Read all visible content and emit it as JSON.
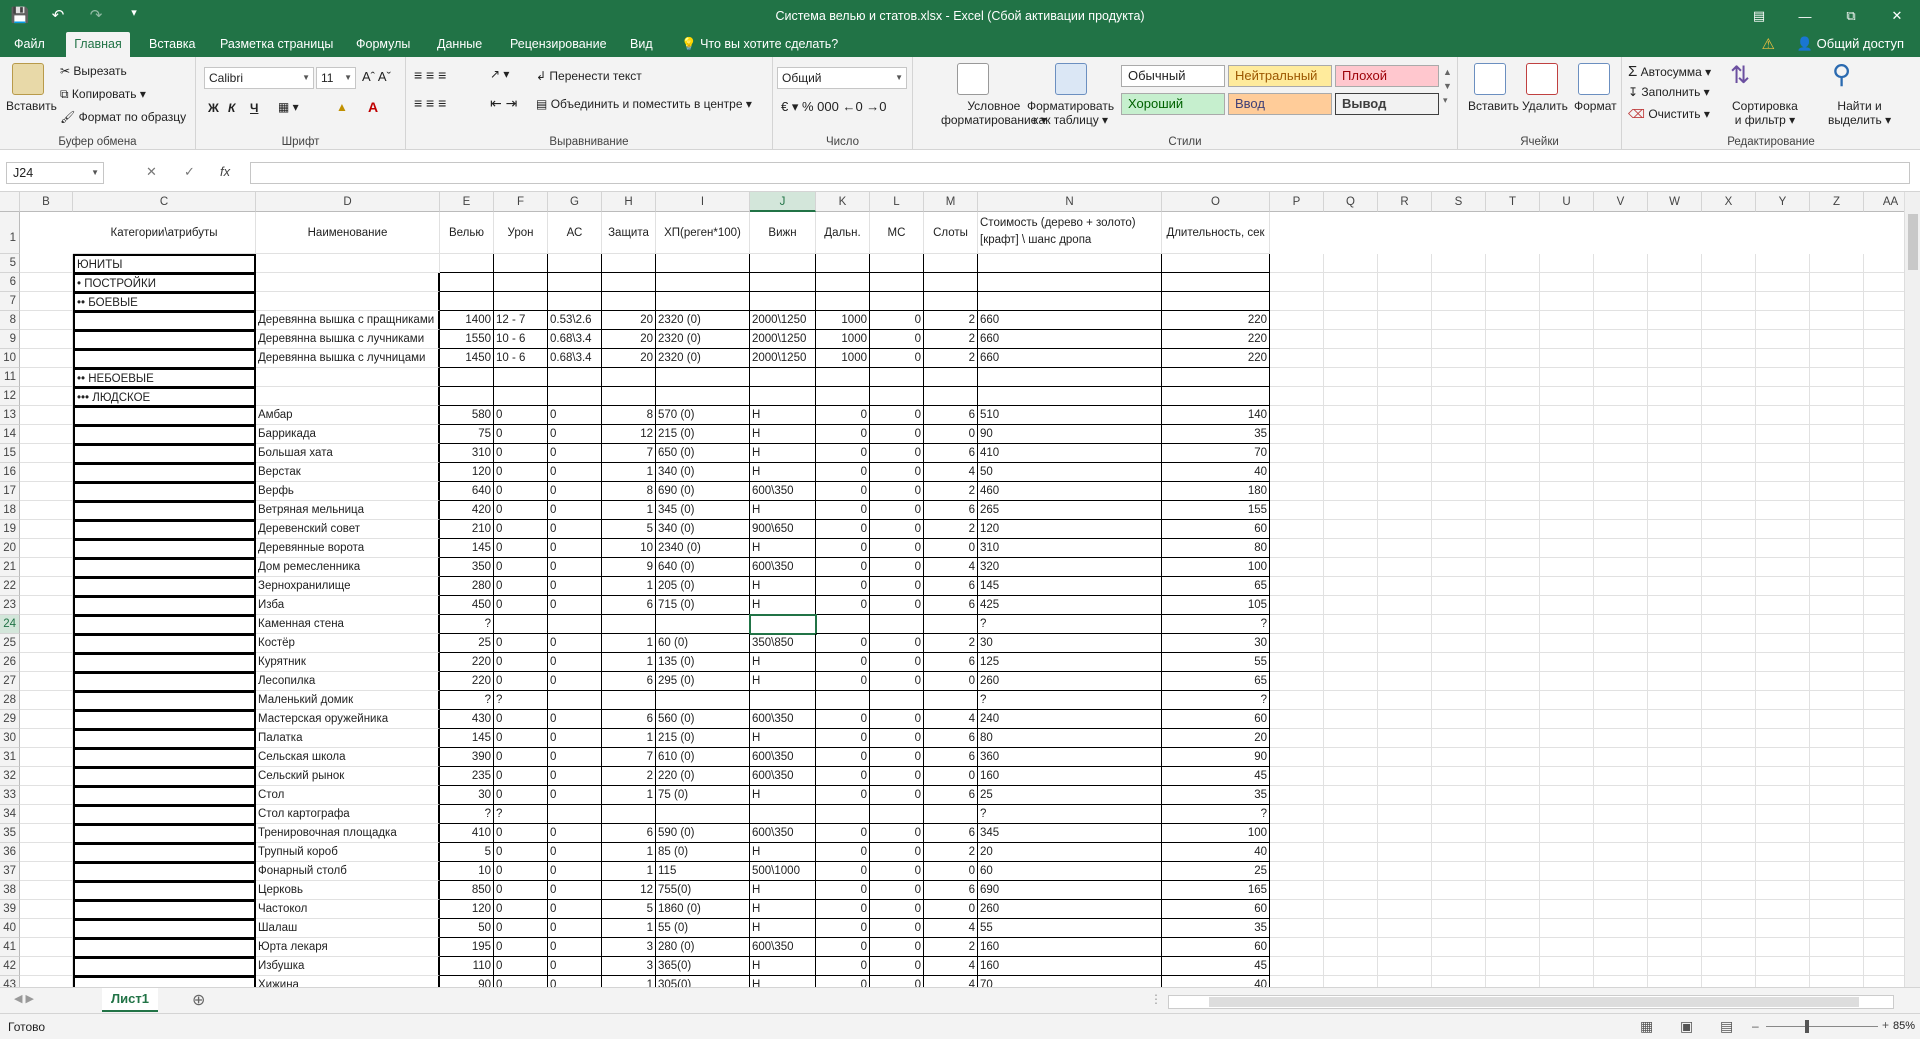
{
  "window": {
    "title": "Система велью и статов.xlsx - Excel (Сбой активации продукта)",
    "share": "Общий доступ"
  },
  "tabs": [
    "Файл",
    "Главная",
    "Вставка",
    "Разметка страницы",
    "Формулы",
    "Данные",
    "Рецензирование",
    "Вид",
    "Что вы хотите сделать?"
  ],
  "ribbon": {
    "clipboard": {
      "paste": "Вставить",
      "cut": "Вырезать",
      "copy": "Копировать",
      "format_painter": "Формат по образцу",
      "label": "Буфер обмена"
    },
    "font": {
      "name": "Calibri",
      "size": "11",
      "bold": "Ж",
      "italic": "К",
      "underline": "Ч",
      "label": "Шрифт"
    },
    "alignment": {
      "wrap": "Перенести текст",
      "merge": "Объединить и поместить в центре",
      "label": "Выравнивание"
    },
    "number": {
      "format": "Общий",
      "label": "Число"
    },
    "styles": {
      "conditional": "Условное",
      "conditional2": "форматирование",
      "as_table": "Форматировать",
      "as_table2": "как таблицу",
      "normal": "Обычный",
      "neutral": "Нейтральный",
      "bad": "Плохой",
      "good": "Хороший",
      "input": "Ввод",
      "output": "Вывод",
      "label": "Стили"
    },
    "cells": {
      "insert": "Вставить",
      "delete": "Удалить",
      "format": "Формат",
      "label": "Ячейки"
    },
    "editing": {
      "autosum": "Автосумма",
      "fill": "Заполнить",
      "clear": "Очистить",
      "sort": "Сортировка",
      "sort2": "и фильтр",
      "find": "Найти и",
      "find2": "выделить",
      "label": "Редактирование"
    }
  },
  "formula_bar": {
    "name_box": "J24",
    "fx": "fx",
    "value": ""
  },
  "columns": [
    {
      "id": "B"
    },
    {
      "id": "C"
    },
    {
      "id": "D"
    },
    {
      "id": "E"
    },
    {
      "id": "F"
    },
    {
      "id": "G"
    },
    {
      "id": "H"
    },
    {
      "id": "I"
    },
    {
      "id": "J"
    },
    {
      "id": "K"
    },
    {
      "id": "L"
    },
    {
      "id": "M"
    },
    {
      "id": "N"
    },
    {
      "id": "O"
    },
    {
      "id": "P"
    },
    {
      "id": "Q"
    },
    {
      "id": "R"
    },
    {
      "id": "S"
    },
    {
      "id": "T"
    },
    {
      "id": "U"
    },
    {
      "id": "V"
    },
    {
      "id": "W"
    },
    {
      "id": "X"
    },
    {
      "id": "Y"
    },
    {
      "id": "Z"
    },
    {
      "id": "AA"
    }
  ],
  "header_row": {
    "num": "1",
    "C": "Категории\\атрибуты",
    "D": "Наименование",
    "E": "Велью",
    "F": "Урон",
    "G": "АС",
    "H": "Защита",
    "I": "ХП(реген*100)",
    "J": "Вижн",
    "K": "Дальн.",
    "L": "МС",
    "M": "Слоты",
    "N1": "Стоимость (дерево + золото)",
    "N2": "[крафт] \\ шанс дропа",
    "O": "Длительность, сек"
  },
  "rows": [
    {
      "n": "5",
      "C": "ЮНИТЫ"
    },
    {
      "n": "6",
      "C": "• ПОСТРОЙКИ"
    },
    {
      "n": "7",
      "C": "•• БОЕВЫЕ"
    },
    {
      "n": "8",
      "D": "Деревянна вышка с пращниками",
      "E": "1400",
      "F": "12 - 7",
      "G": "0.53\\2.6",
      "H": "20",
      "I": "2320 (0)",
      "J": "2000\\1250",
      "K": "1000",
      "L": "0",
      "M": "2",
      "N": "660",
      "O": "220"
    },
    {
      "n": "9",
      "D": "Деревянна вышка с лучниками",
      "E": "1550",
      "F": "10 - 6",
      "G": "0.68\\3.4",
      "H": "20",
      "I": "2320 (0)",
      "J": "2000\\1250",
      "K": "1000",
      "L": "0",
      "M": "2",
      "N": "660",
      "O": "220"
    },
    {
      "n": "10",
      "D": "Деревянна вышка с лучницами",
      "E": "1450",
      "F": "10 - 6",
      "G": "0.68\\3.4",
      "H": "20",
      "I": "2320 (0)",
      "J": "2000\\1250",
      "K": "1000",
      "L": "0",
      "M": "2",
      "N": "660",
      "O": "220"
    },
    {
      "n": "11",
      "C": "•• НЕБОЕВЫЕ"
    },
    {
      "n": "12",
      "C": "••• ЛЮДСКОЕ"
    },
    {
      "n": "13",
      "D": "Амбар",
      "E": "580",
      "F": "0",
      "G": "0",
      "H": "8",
      "I": "570 (0)",
      "J": "Н",
      "K": "0",
      "L": "0",
      "M": "6",
      "N": "510",
      "O": "140"
    },
    {
      "n": "14",
      "D": "Баррикада",
      "E": "75",
      "F": "0",
      "G": "0",
      "H": "12",
      "I": "215 (0)",
      "J": "Н",
      "K": "0",
      "L": "0",
      "M": "0",
      "N": "90",
      "O": "35"
    },
    {
      "n": "15",
      "D": "Большая хата",
      "E": "310",
      "F": "0",
      "G": "0",
      "H": "7",
      "I": "650 (0)",
      "J": "Н",
      "K": "0",
      "L": "0",
      "M": "6",
      "N": "410",
      "O": "70"
    },
    {
      "n": "16",
      "D": "Верстак",
      "E": "120",
      "F": "0",
      "G": "0",
      "H": "1",
      "I": "340 (0)",
      "J": "Н",
      "K": "0",
      "L": "0",
      "M": "4",
      "N": "50",
      "O": "40"
    },
    {
      "n": "17",
      "D": "Верфь",
      "E": "640",
      "F": "0",
      "G": "0",
      "H": "8",
      "I": "690 (0)",
      "J": "600\\350",
      "K": "0",
      "L": "0",
      "M": "2",
      "N": "460",
      "O": "180"
    },
    {
      "n": "18",
      "D": "Ветряная мельница",
      "E": "420",
      "F": "0",
      "G": "0",
      "H": "1",
      "I": "345 (0)",
      "J": "Н",
      "K": "0",
      "L": "0",
      "M": "6",
      "N": "265",
      "O": "155"
    },
    {
      "n": "19",
      "D": "Деревенский совет",
      "E": "210",
      "F": "0",
      "G": "0",
      "H": "5",
      "I": "340 (0)",
      "J": "900\\650",
      "K": "0",
      "L": "0",
      "M": "2",
      "N": "120",
      "O": "60"
    },
    {
      "n": "20",
      "D": "Деревянные ворота",
      "E": "145",
      "F": "0",
      "G": "0",
      "H": "10",
      "I": "2340 (0)",
      "J": "Н",
      "K": "0",
      "L": "0",
      "M": "0",
      "N": "310",
      "O": "80"
    },
    {
      "n": "21",
      "D": "Дом ремесленника",
      "E": "350",
      "F": "0",
      "G": "0",
      "H": "9",
      "I": "640 (0)",
      "J": "600\\350",
      "K": "0",
      "L": "0",
      "M": "4",
      "N": "320",
      "O": "100"
    },
    {
      "n": "22",
      "D": "Зернохранилище",
      "E": "280",
      "F": "0",
      "G": "0",
      "H": "1",
      "I": "205 (0)",
      "J": "Н",
      "K": "0",
      "L": "0",
      "M": "6",
      "N": "145",
      "O": "65"
    },
    {
      "n": "23",
      "D": "Изба",
      "E": "450",
      "F": "0",
      "G": "0",
      "H": "6",
      "I": "715 (0)",
      "J": "Н",
      "K": "0",
      "L": "0",
      "M": "6",
      "N": "425",
      "O": "105"
    },
    {
      "n": "24",
      "D": "Каменная стена",
      "E": "?",
      "N": "?",
      "O": "?"
    },
    {
      "n": "25",
      "D": "Костёр",
      "E": "25",
      "F": "0",
      "G": "0",
      "H": "1",
      "I": "60 (0)",
      "J": "350\\850",
      "K": "0",
      "L": "0",
      "M": "2",
      "N": "30",
      "O": "30"
    },
    {
      "n": "26",
      "D": "Курятник",
      "E": "220",
      "F": "0",
      "G": "0",
      "H": "1",
      "I": "135 (0)",
      "J": "Н",
      "K": "0",
      "L": "0",
      "M": "6",
      "N": "125",
      "O": "55"
    },
    {
      "n": "27",
      "D": "Лесопилка",
      "E": "220",
      "F": "0",
      "G": "0",
      "H": "6",
      "I": "295 (0)",
      "J": "Н",
      "K": "0",
      "L": "0",
      "M": "0",
      "N": "260",
      "O": "65"
    },
    {
      "n": "28",
      "D": "Маленький домик",
      "E": "?",
      "F": "?",
      "N": "?",
      "O": "?"
    },
    {
      "n": "29",
      "D": "Мастерская оружейника",
      "E": "430",
      "F": "0",
      "G": "0",
      "H": "6",
      "I": "560 (0)",
      "J": "600\\350",
      "K": "0",
      "L": "0",
      "M": "4",
      "N": "240",
      "O": "60"
    },
    {
      "n": "30",
      "D": "Палатка",
      "E": "145",
      "F": "0",
      "G": "0",
      "H": "1",
      "I": "215 (0)",
      "J": "Н",
      "K": "0",
      "L": "0",
      "M": "6",
      "N": "80",
      "O": "20"
    },
    {
      "n": "31",
      "D": "Сельская школа",
      "E": "390",
      "F": "0",
      "G": "0",
      "H": "7",
      "I": "610 (0)",
      "J": "600\\350",
      "K": "0",
      "L": "0",
      "M": "6",
      "N": "360",
      "O": "90"
    },
    {
      "n": "32",
      "D": "Сельский рынок",
      "E": "235",
      "F": "0",
      "G": "0",
      "H": "2",
      "I": "220 (0)",
      "J": "600\\350",
      "K": "0",
      "L": "0",
      "M": "0",
      "N": "160",
      "O": "45"
    },
    {
      "n": "33",
      "D": "Стол",
      "E": "30",
      "F": "0",
      "G": "0",
      "H": "1",
      "I": "75 (0)",
      "J": "Н",
      "K": "0",
      "L": "0",
      "M": "6",
      "N": "25",
      "O": "35"
    },
    {
      "n": "34",
      "D": "Стол картографа",
      "E": "?",
      "F": "?",
      "N": "?",
      "O": "?"
    },
    {
      "n": "35",
      "D": "Тренировочная площадка",
      "E": "410",
      "F": "0",
      "G": "0",
      "H": "6",
      "I": "590 (0)",
      "J": "600\\350",
      "K": "0",
      "L": "0",
      "M": "6",
      "N": "345",
      "O": "100"
    },
    {
      "n": "36",
      "D": "Трупный короб",
      "E": "5",
      "F": "0",
      "G": "0",
      "H": "1",
      "I": "85 (0)",
      "J": "Н",
      "K": "0",
      "L": "0",
      "M": "2",
      "N": "20",
      "O": "40"
    },
    {
      "n": "37",
      "D": "Фонарный столб",
      "E": "10",
      "F": "0",
      "G": "0",
      "H": "1",
      "I": "115",
      "J": "500\\1000",
      "K": "0",
      "L": "0",
      "M": "0",
      "N": "60",
      "O": "25"
    },
    {
      "n": "38",
      "D": "Церковь",
      "E": "850",
      "F": "0",
      "G": "0",
      "H": "12",
      "I": "755(0)",
      "J": "Н",
      "K": "0",
      "L": "0",
      "M": "6",
      "N": "690",
      "O": "165"
    },
    {
      "n": "39",
      "D": "Частокол",
      "E": "120",
      "F": "0",
      "G": "0",
      "H": "5",
      "I": "1860 (0)",
      "J": "Н",
      "K": "0",
      "L": "0",
      "M": "0",
      "N": "260",
      "O": "60"
    },
    {
      "n": "40",
      "D": "Шалаш",
      "E": "50",
      "F": "0",
      "G": "0",
      "H": "1",
      "I": "55 (0)",
      "J": "Н",
      "K": "0",
      "L": "0",
      "M": "4",
      "N": "55",
      "O": "35"
    },
    {
      "n": "41",
      "D": "Юрта лекаря",
      "E": "195",
      "F": "0",
      "G": "0",
      "H": "3",
      "I": "280 (0)",
      "J": "600\\350",
      "K": "0",
      "L": "0",
      "M": "2",
      "N": "160",
      "O": "60"
    },
    {
      "n": "42",
      "D": "Избушка",
      "E": "110",
      "F": "0",
      "G": "0",
      "H": "3",
      "I": "365(0)",
      "J": "Н",
      "K": "0",
      "L": "0",
      "M": "4",
      "N": "160",
      "O": "45"
    },
    {
      "n": "43",
      "D": "Хижина",
      "E": "90",
      "F": "0",
      "G": "0",
      "H": "1",
      "I": "305(0)",
      "J": "Н",
      "K": "0",
      "L": "0",
      "M": "4",
      "N": "70",
      "O": "40"
    }
  ],
  "sheet": {
    "tab": "Лист1"
  },
  "status": {
    "text": "Готово",
    "zoom": "85%"
  },
  "colors": {
    "accent": "#217346",
    "neutral": "#ffeb9c",
    "bad": "#ffc7ce",
    "good": "#c6efce",
    "input": "#ffcc99",
    "output": "#f2f2f2"
  }
}
